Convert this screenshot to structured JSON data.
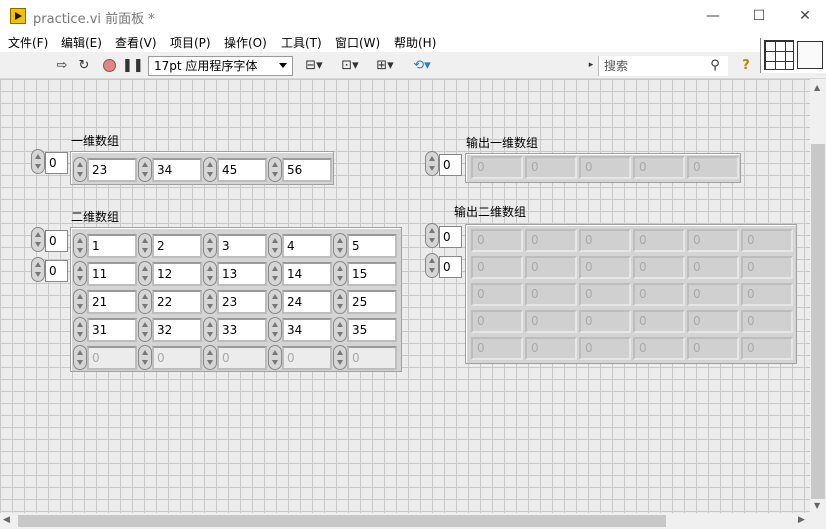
{
  "window": {
    "title": "practice.vi 前面板 *",
    "minimize": "—",
    "maximize": "☐",
    "close": "✕"
  },
  "menu": [
    "文件(F)",
    "编辑(E)",
    "查看(V)",
    "项目(P)",
    "操作(O)",
    "工具(T)",
    "窗口(W)",
    "帮助(H)"
  ],
  "toolbar": {
    "font": "17pt 应用程序字体",
    "search_placeholder": "搜索",
    "help": "?"
  },
  "arrays": {
    "a1d": {
      "label": "一维数组",
      "index": "0",
      "values": [
        "23",
        "34",
        "45",
        "56"
      ]
    },
    "a2d": {
      "label": "二维数组",
      "row_index": "0",
      "col_index": "0",
      "rows": [
        [
          "1",
          "2",
          "3",
          "4",
          "5"
        ],
        [
          "11",
          "12",
          "13",
          "14",
          "15"
        ],
        [
          "21",
          "22",
          "23",
          "24",
          "25"
        ],
        [
          "31",
          "32",
          "33",
          "34",
          "35"
        ],
        [
          "0",
          "0",
          "0",
          "0",
          "0"
        ]
      ]
    },
    "o1d": {
      "label": "输出一维数组",
      "index": "0",
      "values": [
        "0",
        "0",
        "0",
        "0",
        "0"
      ]
    },
    "o2d": {
      "label": "输出二维数组",
      "row_index": "0",
      "col_index": "0",
      "rows": [
        [
          "0",
          "0",
          "0",
          "0",
          "0",
          "0"
        ],
        [
          "0",
          "0",
          "0",
          "0",
          "0",
          "0"
        ],
        [
          "0",
          "0",
          "0",
          "0",
          "0",
          "0"
        ],
        [
          "0",
          "0",
          "0",
          "0",
          "0",
          "0"
        ],
        [
          "0",
          "0",
          "0",
          "0",
          "0",
          "0"
        ]
      ]
    }
  }
}
